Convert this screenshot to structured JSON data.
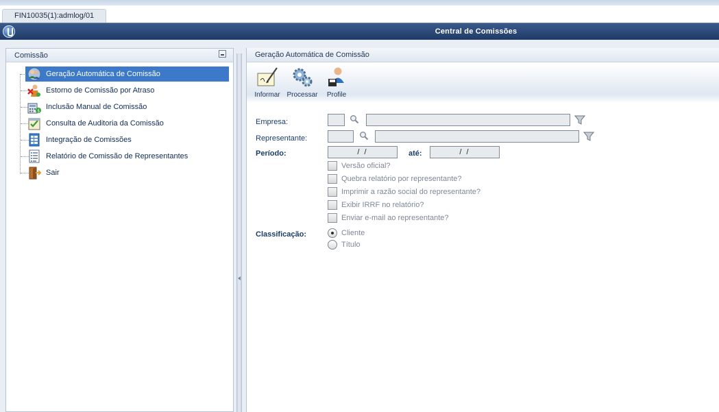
{
  "window": {
    "tab_label": "FIN10035(1):admlog/01",
    "title": "Central de Comissões"
  },
  "left_panel": {
    "header": "Comissão",
    "items": [
      {
        "label": "Geração Automática de Comissão",
        "icon": "people-auto-icon",
        "selected": true
      },
      {
        "label": "Estorno de Comissão por Atraso",
        "icon": "person-cancel-icon",
        "selected": false
      },
      {
        "label": "Inclusão Manual de Comissão",
        "icon": "calculator-money-icon",
        "selected": false
      },
      {
        "label": "Consulta de Auditoria da Comissão",
        "icon": "audit-check-icon",
        "selected": false
      },
      {
        "label": "Integração de Comissões",
        "icon": "spreadsheet-icon",
        "selected": false
      },
      {
        "label": "Relatório de Comissão de Representantes",
        "icon": "report-list-icon",
        "selected": false
      },
      {
        "label": "Sair",
        "icon": "exit-door-icon",
        "selected": false
      }
    ]
  },
  "right_panel": {
    "header": "Geração Automática de Comissão",
    "toolbar": {
      "informar": "Informar",
      "processar": "Processar",
      "profile": "Profile"
    },
    "form": {
      "empresa_label": "Empresa:",
      "representante_label": "Representante:",
      "periodo_label": "Período:",
      "periodo_start": "/ /",
      "ate_label": "até:",
      "periodo_end": "/ /",
      "checkboxes": [
        "Versão oficial?",
        "Quebra relatório por representante?",
        "Imprimir a razão social do representante?",
        "Exibir IRRF no relatório?",
        "Enviar e-mail ao representante?"
      ],
      "classificacao_label": "Classificação:",
      "radios": [
        {
          "label": "Cliente",
          "selected": true
        },
        {
          "label": "Título",
          "selected": false
        }
      ]
    }
  }
}
